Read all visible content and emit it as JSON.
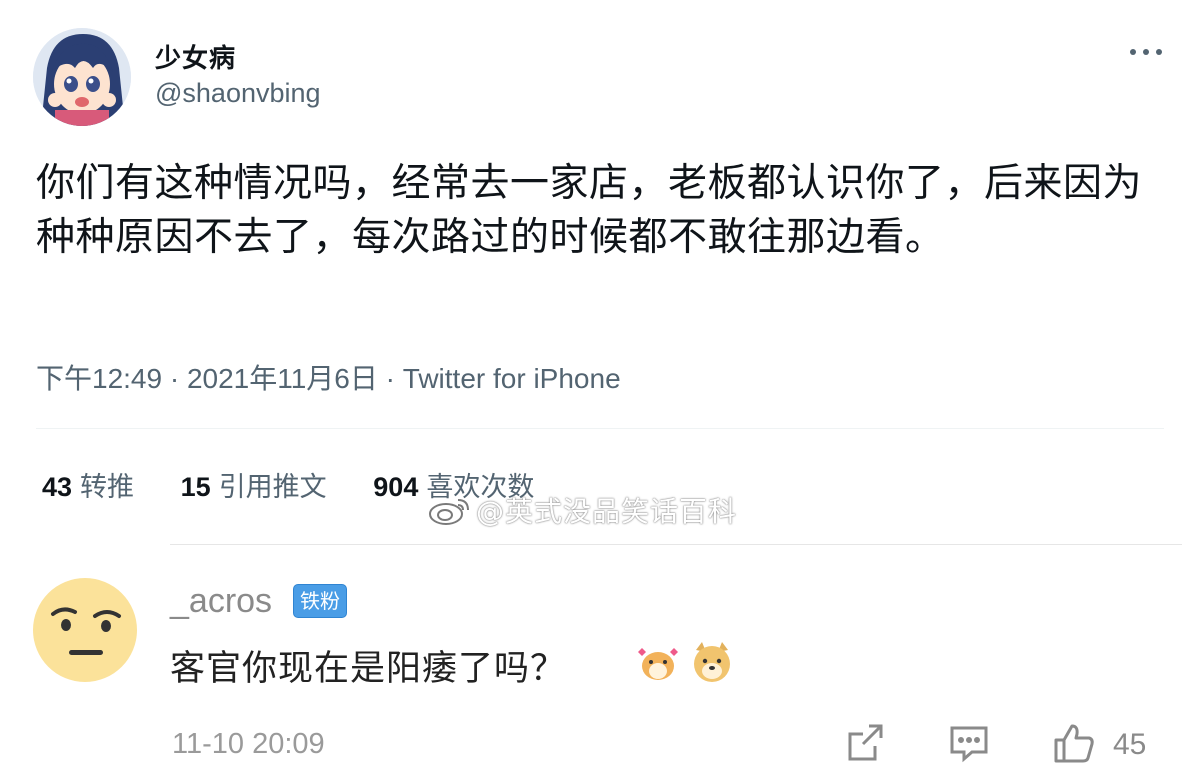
{
  "tweet": {
    "display_name": "少女病",
    "handle": "@shaonvbing",
    "text": "你们有这种情况吗，经常去一家店，老板都认识你了，后来因为种种原因不去了，每次路过的时候都不敢往那边看。",
    "meta": "下午12:49 · 2021年11月6日 · Twitter for iPhone",
    "avatar_icon": "anime-avatar",
    "more_icon": "more-dots-icon",
    "stats": [
      {
        "count": "43",
        "label": "转推"
      },
      {
        "count": "15",
        "label": "引用推文"
      },
      {
        "count": "904",
        "label": "喜欢次数"
      }
    ]
  },
  "watermark": {
    "text": "@英式没品笑话百科",
    "icon": "weibo-logo-icon"
  },
  "comment": {
    "username": "_acros",
    "badge": "铁粉",
    "text": "客官你现在是阳痿了吗？",
    "emojis": [
      "hamster-emoji",
      "doge-emoji"
    ],
    "time": "11-10 20:09",
    "actions": {
      "share_icon": "share-icon",
      "reply_icon": "comment-icon",
      "like_icon": "thumbs-up-icon",
      "like_count": "45"
    }
  },
  "colors": {
    "secondary_text": "#536471",
    "badge_blue": "#4a9de6",
    "divider": "#eff3f4"
  }
}
